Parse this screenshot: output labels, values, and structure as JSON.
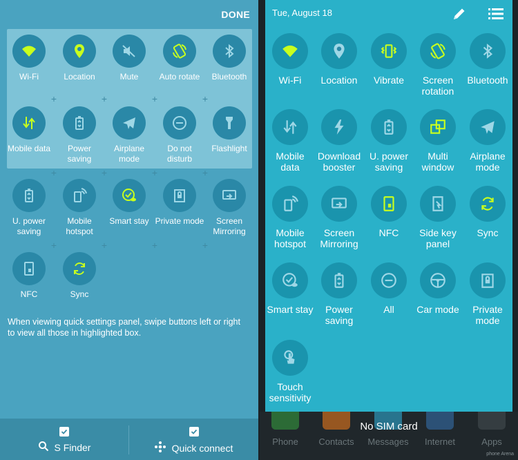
{
  "left_panel": {
    "done_label": "DONE",
    "highlighted_row1": [
      {
        "label": "Wi-Fi",
        "icon": "wifi-icon",
        "active": true
      },
      {
        "label": "Location",
        "icon": "location-icon",
        "active": true
      },
      {
        "label": "Mute",
        "icon": "mute-icon",
        "active": false
      },
      {
        "label": "Auto rotate",
        "icon": "auto-rotate-icon",
        "active": true
      },
      {
        "label": "Bluetooth",
        "icon": "bluetooth-icon",
        "active": false
      }
    ],
    "highlighted_row2": [
      {
        "label": "Mobile data",
        "icon": "mobile-data-icon",
        "active": true
      },
      {
        "label": "Power saving",
        "icon": "power-saving-icon",
        "active": false
      },
      {
        "label": "Airplane mode",
        "icon": "airplane-icon",
        "active": false
      },
      {
        "label": "Do not disturb",
        "icon": "do-not-disturb-icon",
        "active": false
      },
      {
        "label": "Flashlight",
        "icon": "flashlight-icon",
        "active": false
      }
    ],
    "row3": [
      {
        "label": "U. power saving",
        "icon": "ultra-power-saving-icon",
        "active": false
      },
      {
        "label": "Mobile hotspot",
        "icon": "hotspot-icon",
        "active": false
      },
      {
        "label": "Smart stay",
        "icon": "smart-stay-icon",
        "active": true
      },
      {
        "label": "Private mode",
        "icon": "private-mode-icon",
        "active": false
      },
      {
        "label": "Screen Mirroring",
        "icon": "screen-mirroring-icon",
        "active": false
      }
    ],
    "row4": [
      {
        "label": "NFC",
        "icon": "nfc-icon",
        "active": false
      },
      {
        "label": "Sync",
        "icon": "sync-icon",
        "active": true
      }
    ],
    "hint_text": "When viewing quick settings panel, swipe buttons left or right to view all those in highlighted box.",
    "bottom_bar": {
      "s_finder_label": "S Finder",
      "quick_connect_label": "Quick connect"
    }
  },
  "right_panel": {
    "date": "Tue, August 18",
    "rows": [
      [
        {
          "label": "Wi-Fi",
          "icon": "wifi-icon",
          "active": true
        },
        {
          "label": "Location",
          "icon": "location-icon",
          "active": false
        },
        {
          "label": "Vibrate",
          "icon": "vibrate-icon",
          "active": true
        },
        {
          "label": "Screen rotation",
          "icon": "screen-rotation-icon",
          "active": true
        },
        {
          "label": "Bluetooth",
          "icon": "bluetooth-icon",
          "active": false
        }
      ],
      [
        {
          "label": "Mobile data",
          "icon": "mobile-data-icon",
          "active": false
        },
        {
          "label": "Download booster",
          "icon": "download-booster-icon",
          "active": false
        },
        {
          "label": "U. power saving",
          "icon": "ultra-power-saving-icon",
          "active": false
        },
        {
          "label": "Multi window",
          "icon": "multi-window-icon",
          "active": true
        },
        {
          "label": "Airplane mode",
          "icon": "airplane-icon",
          "active": false
        }
      ],
      [
        {
          "label": "Mobile hotspot",
          "icon": "hotspot-icon",
          "active": false
        },
        {
          "label": "Screen Mirroring",
          "icon": "screen-mirroring-icon",
          "active": false
        },
        {
          "label": "NFC",
          "icon": "nfc-icon",
          "active": true
        },
        {
          "label": "Side key panel",
          "icon": "side-key-panel-icon",
          "active": false
        },
        {
          "label": "Sync",
          "icon": "sync-icon",
          "active": true
        }
      ],
      [
        {
          "label": "Smart stay",
          "icon": "smart-stay-icon",
          "active": false
        },
        {
          "label": "Power saving",
          "icon": "power-saving-icon",
          "active": false
        },
        {
          "label": "All",
          "icon": "do-not-disturb-icon",
          "active": false
        },
        {
          "label": "Car mode",
          "icon": "car-mode-icon",
          "active": false
        },
        {
          "label": "Private mode",
          "icon": "private-mode-icon",
          "active": false
        }
      ],
      [
        {
          "label": "Touch sensitivity",
          "icon": "touch-sensitivity-icon",
          "active": false
        }
      ]
    ],
    "no_sim": "No SIM card",
    "dock": [
      {
        "label": "Phone",
        "icon": "phone-app-icon"
      },
      {
        "label": "Contacts",
        "icon": "contacts-app-icon"
      },
      {
        "label": "Messages",
        "icon": "messages-app-icon"
      },
      {
        "label": "Internet",
        "icon": "internet-app-icon"
      },
      {
        "label": "Apps",
        "icon": "apps-grid-icon"
      }
    ],
    "watermark": "phone Arena"
  },
  "colors": {
    "active": "#c8ff1e",
    "inactive": "#9ed7e6"
  }
}
